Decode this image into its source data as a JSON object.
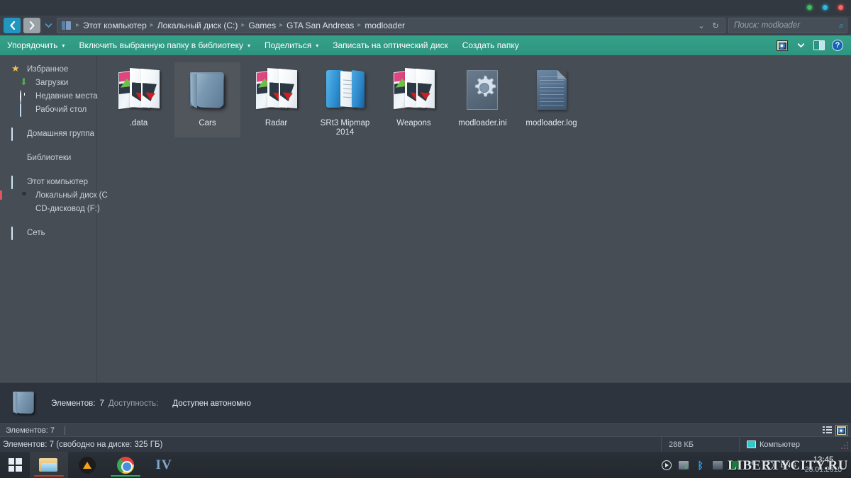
{
  "window": {
    "title_bar_color": "#333941",
    "controls": [
      {
        "name": "minimize",
        "color": "#3fbb6a"
      },
      {
        "name": "maximize",
        "color": "#2fb9dd"
      },
      {
        "name": "close",
        "color": "#f2676a"
      }
    ]
  },
  "address_bar": {
    "back_label": "‹",
    "forward_label": "›",
    "history_label": "▾",
    "breadcrumbs": [
      "Этот компьютер",
      "Локальный диск (C:)",
      "Games",
      "GTA San Andreas",
      "modloader"
    ],
    "separator": "▸",
    "dropdown_label": "⌄",
    "refresh_label": "↻"
  },
  "search": {
    "placeholder": "Поиск: modloader",
    "icon_label": "⌕"
  },
  "toolbar": {
    "accent_color": "#2e9481",
    "items": [
      {
        "label": "Упорядочить",
        "has_caret": true
      },
      {
        "label": "Включить выбранную папку в библиотеку",
        "has_caret": true
      },
      {
        "label": "Поделиться",
        "has_caret": true
      },
      {
        "label": "Записать на оптический диск",
        "has_caret": false
      },
      {
        "label": "Создать папку",
        "has_caret": false
      }
    ],
    "caret": "▾",
    "right_icons": [
      "view-options-icon",
      "chevron-down-icon",
      "preview-pane-icon",
      "help-icon"
    ],
    "help_label": "?"
  },
  "sidebar": {
    "groups": [
      {
        "header": {
          "label": "Избранное",
          "icon": "star-icon"
        },
        "items": [
          {
            "label": "Загрузки",
            "icon": "download-icon"
          },
          {
            "label": "Недавние места",
            "icon": "recent-places-icon"
          },
          {
            "label": "Рабочий стол",
            "icon": "desktop-icon"
          }
        ]
      },
      {
        "header": {
          "label": "Домашняя группа",
          "icon": "homegroup-icon"
        },
        "items": []
      },
      {
        "header": {
          "label": "Библиотеки",
          "icon": "libraries-icon"
        },
        "items": []
      },
      {
        "header": {
          "label": "Этот компьютер",
          "icon": "computer-icon"
        },
        "items": [
          {
            "label": "Локальный диск (C",
            "icon": "hard-drive-icon",
            "marked": true
          },
          {
            "label": "CD-дисковод (F:)",
            "icon": "cd-drive-icon"
          }
        ]
      },
      {
        "header": {
          "label": "Сеть",
          "icon": "network-icon"
        },
        "items": []
      }
    ]
  },
  "files": [
    {
      "name": ".data",
      "icon": "texture-folder-icon",
      "selected": false
    },
    {
      "name": "Cars",
      "icon": "plain-folder-icon",
      "selected": true
    },
    {
      "name": "Radar",
      "icon": "texture-folder-icon",
      "selected": false
    },
    {
      "name": "SRt3 Mipmap 2014",
      "icon": "book-folder-icon",
      "selected": false
    },
    {
      "name": "Weapons",
      "icon": "texture-folder-icon",
      "selected": false
    },
    {
      "name": "modloader.ini",
      "icon": "ini-file-icon",
      "selected": false
    },
    {
      "name": "modloader.log",
      "icon": "log-file-icon",
      "selected": false
    }
  ],
  "details_pane": {
    "icon": "folder-icon",
    "items_label": "Элементов:",
    "items_value": "7",
    "availability_label": "Доступность:",
    "availability_value": "Доступен автономно"
  },
  "status_bar_top": {
    "text": "Элементов: 7",
    "view_icons": [
      "list-view-icon",
      "thumbnail-view-icon"
    ]
  },
  "status_bar_bottom": {
    "text": "Элементов: 7 (свободно на диске: 325 ГБ)",
    "size": "288 КБ",
    "computer_label": "Компьютер"
  },
  "taskbar": {
    "start_icon": "windows-logo-icon",
    "tasks": [
      {
        "name": "explorer",
        "icon": "file-explorer-icon",
        "active": true,
        "underline": "#c0392b"
      },
      {
        "name": "aimp",
        "icon": "aimp-icon",
        "active": false,
        "underline": ""
      },
      {
        "name": "chrome",
        "icon": "chrome-icon",
        "active": true,
        "underline": "#27ae60"
      },
      {
        "name": "gta-iv",
        "icon": "gta-iv-icon",
        "active": false,
        "underline": "",
        "label": "IV"
      }
    ],
    "tray_icons": [
      "media-player-icon",
      "network-icon",
      "bluetooth-icon",
      "volume-icon",
      "flag-icon",
      "keyboard-layout-icon",
      "fan-icon"
    ],
    "language": "ENG",
    "clock_time": "13:45",
    "clock_date": "23.01.2015"
  },
  "watermark": {
    "text": "LIBERTYCITY.RU"
  }
}
